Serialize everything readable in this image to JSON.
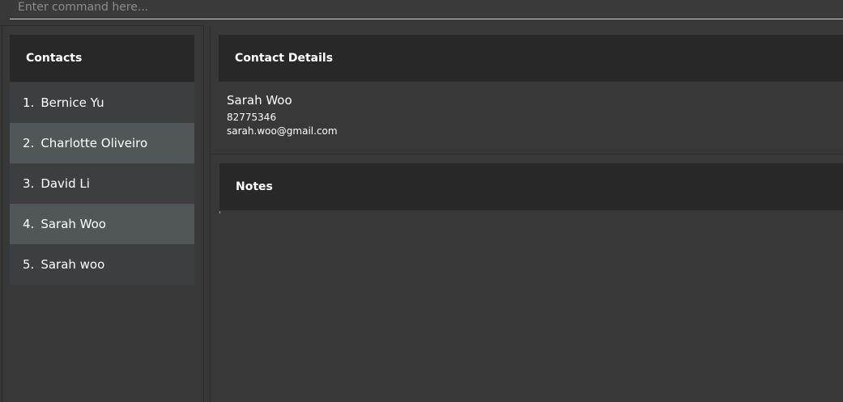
{
  "command": {
    "placeholder": "Enter command here...",
    "value": ""
  },
  "contacts_panel": {
    "title": "Contacts",
    "items": [
      {
        "index": "1.",
        "name": "Bernice Yu"
      },
      {
        "index": "2.",
        "name": "Charlotte Oliveiro"
      },
      {
        "index": "3.",
        "name": "David Li"
      },
      {
        "index": "4.",
        "name": "Sarah Woo"
      },
      {
        "index": "5.",
        "name": "Sarah woo"
      }
    ]
  },
  "details_panel": {
    "title": "Contact Details",
    "name": "Sarah Woo",
    "phone": "82775346",
    "email": "sarah.woo@gmail.com"
  },
  "notes_panel": {
    "title": "Notes",
    "content": ""
  },
  "colors": {
    "background": "#383838",
    "header": "#282828",
    "row_odd": "#3c3e3f",
    "row_even": "#515658",
    "text": "#ffffff"
  }
}
